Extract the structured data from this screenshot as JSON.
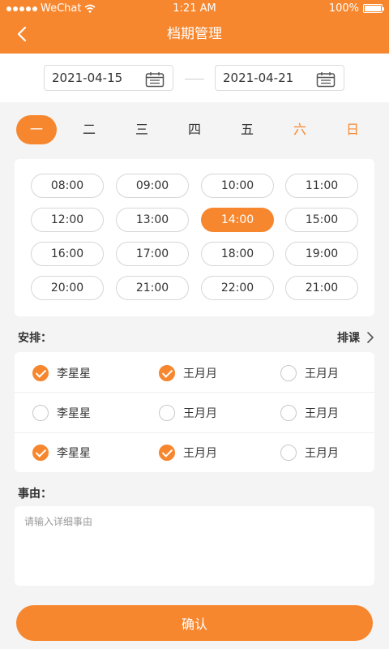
{
  "statusbar": {
    "carrier": "WeChat",
    "time": "1:21 AM",
    "battery": "100%",
    "battery_level": 1.0
  },
  "header": {
    "title": "档期管理",
    "back_icon": "chevron-left-icon"
  },
  "dates": {
    "start": "2021-04-15",
    "end": "2021-04-21",
    "icon": "calendar-icon"
  },
  "weekdays": [
    {
      "label": "一",
      "active": true
    },
    {
      "label": "二"
    },
    {
      "label": "三"
    },
    {
      "label": "四"
    },
    {
      "label": "五"
    },
    {
      "label": "六",
      "weekend": true
    },
    {
      "label": "日",
      "weekend": true
    }
  ],
  "times": [
    [
      "08:00",
      "09:00",
      "10:00",
      "11:00"
    ],
    [
      "12:00",
      "13:00",
      "14:00",
      "15:00"
    ],
    [
      "16:00",
      "17:00",
      "18:00",
      "19:00"
    ],
    [
      "20:00",
      "21:00",
      "22:00",
      "21:00"
    ]
  ],
  "selected_time": "14:00",
  "arrange": {
    "label": "安排：",
    "link_label": "排课",
    "link_icon": "chevron-right-icon"
  },
  "people": [
    [
      {
        "name": "李星星",
        "checked": true
      },
      {
        "name": "王月月",
        "checked": true
      },
      {
        "name": "王月月",
        "checked": false
      }
    ],
    [
      {
        "name": "李星星",
        "checked": false
      },
      {
        "name": "王月月",
        "checked": false
      },
      {
        "name": "王月月",
        "checked": false
      }
    ],
    [
      {
        "name": "李星星",
        "checked": true
      },
      {
        "name": "王月月",
        "checked": true
      },
      {
        "name": "王月月",
        "checked": false
      }
    ]
  ],
  "reason": {
    "label": "事由：",
    "placeholder": "请输入详细事由",
    "value": ""
  },
  "confirm_label": "确认",
  "colors": {
    "accent": "#f7872e",
    "background": "#f4f4f4"
  }
}
